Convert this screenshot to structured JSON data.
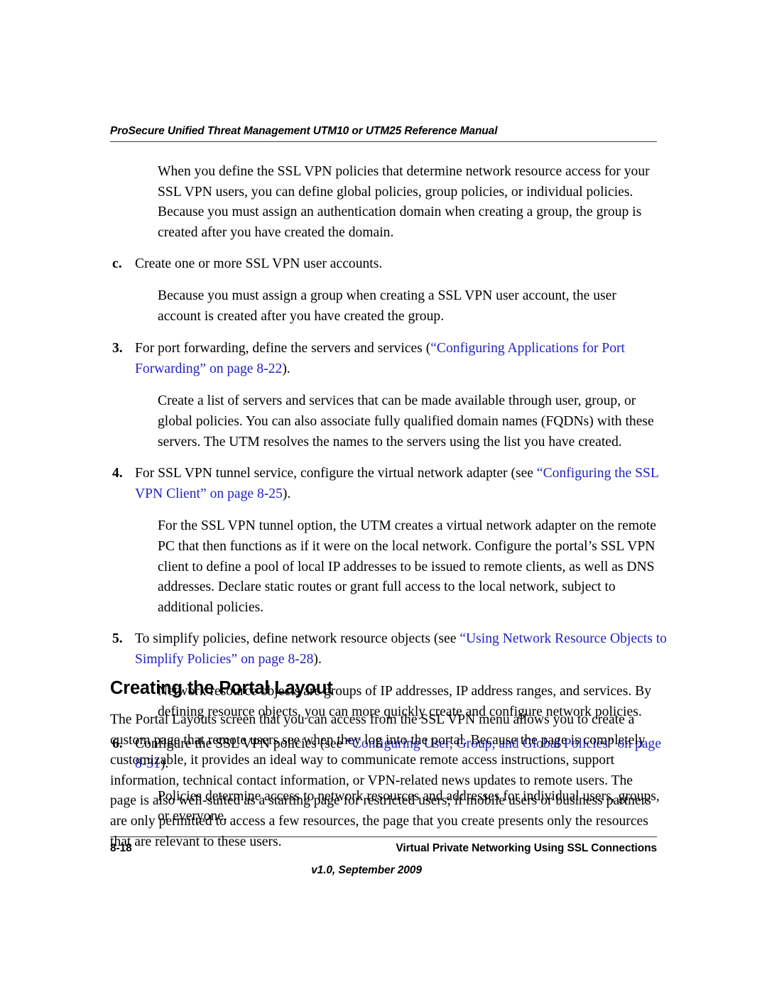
{
  "header": {
    "running_title": "ProSecure Unified Threat Management UTM10 or UTM25 Reference Manual"
  },
  "accent_colors": {
    "cross_reference_blue": "#2222c4",
    "rule_gray": "#3a3a3a",
    "body_text": "#000000"
  },
  "body": {
    "intro_paragraph": "When you define the SSL VPN policies that determine network resource access for your SSL VPN users, you can define global policies, group policies, or individual policies. Because you must assign an authentication domain when creating a group, the group is created after you have created the domain.",
    "item_c": {
      "marker": "c.",
      "text": "Create one or more SSL VPN user accounts."
    },
    "paragraph_after_c": "Because you must assign a group when creating a SSL VPN user account, the user account is created after you have created the group.",
    "item_3": {
      "marker": "3.",
      "text_before": "For port forwarding, define the servers and services (",
      "xref": "“Configuring Applications for Port Forwarding” on page 8-22",
      "text_after": ")."
    },
    "paragraph_after_3": "Create a list of servers and services that can be made available through user, group, or global policies. You can also associate fully qualified domain names (FQDNs) with these servers. The UTM resolves the names to the servers using the list you have created.",
    "item_4": {
      "marker": "4.",
      "text_before": "For SSL VPN tunnel service, configure the virtual network adapter (see ",
      "xref": "“Configuring the SSL VPN Client” on page 8-25",
      "text_after": ")."
    },
    "paragraph_after_4": "For the SSL VPN tunnel option, the UTM creates a virtual network adapter on the remote PC that then functions as if it were on the local network. Configure the portal’s SSL VPN client to define a pool of local IP addresses to be issued to remote clients, as well as DNS addresses. Declare static routes or grant full access to the local network, subject to additional policies.",
    "item_5": {
      "marker": "5.",
      "text_before": "To simplify policies, define network resource objects (see ",
      "xref": "“Using Network Resource Objects to Simplify Policies” on page 8-28",
      "text_after": ")."
    },
    "paragraph_after_5": "Network resource objects are groups of IP addresses, IP address ranges, and services. By defining resource objects, you can more quickly create and configure network policies.",
    "item_6": {
      "marker": "6.",
      "text_before": "Configure the SSL VPN policies (see ",
      "xref": "“Configuring User, Group, and Global Policies” on page 8-31",
      "text_after": ")."
    },
    "paragraph_after_6": "Policies determine access to network resources and addresses for individual users, groups, or everyone."
  },
  "section": {
    "heading": "Creating the Portal Layout",
    "paragraph": "The Portal Layouts screen that you can access from the SSL VPN menu allows you to create a custom page that remote users see when they log into the portal. Because the page is completely customizable, it provides an ideal way to communicate remote access instructions, support information, technical contact information, or VPN-related news updates to remote users. The page is also well-suited as a starting page for restricted users; if mobile users or business partners are only permitted to access a few resources, the page that you create presents only the resources that are relevant to these users."
  },
  "footer": {
    "page_number": "8-18",
    "chapter_title": "Virtual Private Networking Using SSL Connections",
    "version": "v1.0, September 2009"
  }
}
